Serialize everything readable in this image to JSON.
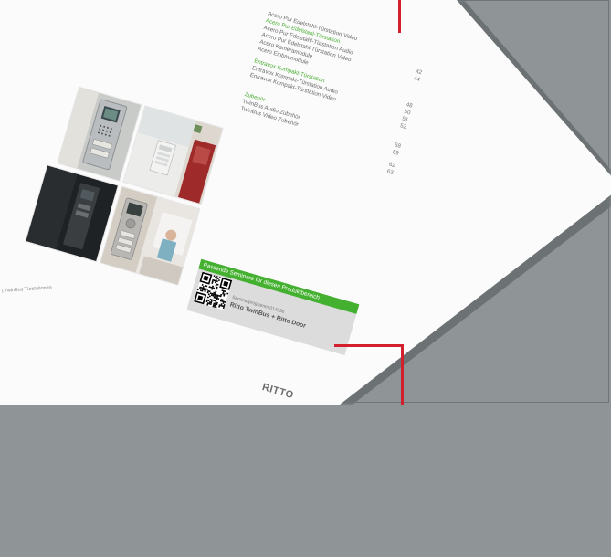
{
  "toc": {
    "rows": [
      {
        "label": "Acero Pur Edelstahl-Türstation Video",
        "page": "",
        "green": false
      },
      {
        "label": "Acero Pur Edelstahl-Türstation",
        "page": "",
        "green": true
      },
      {
        "label": "Acero Pur Edelstahl-Türstation Audio",
        "page": "42",
        "green": false
      },
      {
        "label": "Acero Pur Edelstahl-Türstation Video",
        "page": "44",
        "green": false
      },
      {
        "label": "Acero Kameramodule",
        "page": "",
        "green": false
      },
      {
        "label": "Acero Einbaumodule",
        "page": "",
        "green": false
      },
      {
        "label": "Entravox Kompakt-Türstation",
        "page": "48",
        "green": true
      },
      {
        "label": "Entravox Kompakt-Türstation Audio",
        "page": "50",
        "green": false
      },
      {
        "label": "Entravox Kompakt-Türstation Video",
        "page": "51",
        "green": false
      },
      {
        "label": "",
        "page": "52",
        "green": false
      },
      {
        "label": "Zubehör",
        "page": "",
        "green": true
      },
      {
        "label": "TwinBus Audio Zubehör",
        "page": "58",
        "green": false
      },
      {
        "label": "TwinBus Video Zubehör",
        "page": "59",
        "green": false
      },
      {
        "label": "",
        "page": "62",
        "green": false
      },
      {
        "label": "",
        "page": "63",
        "green": false
      }
    ]
  },
  "seminar": {
    "banner": "Passende Seminare für diesen Produktbereich",
    "subtitle": "Seminarprogramm 014856",
    "title": "Ritto TwinBus + Ritto Door"
  },
  "footer": {
    "left": "| TwinBus Türstationen",
    "brand": "RITTO"
  },
  "colors": {
    "background": "#8f9597",
    "paper": "#fbfbfb",
    "accent_green": "#44b030",
    "marker_red": "#d2202f"
  }
}
